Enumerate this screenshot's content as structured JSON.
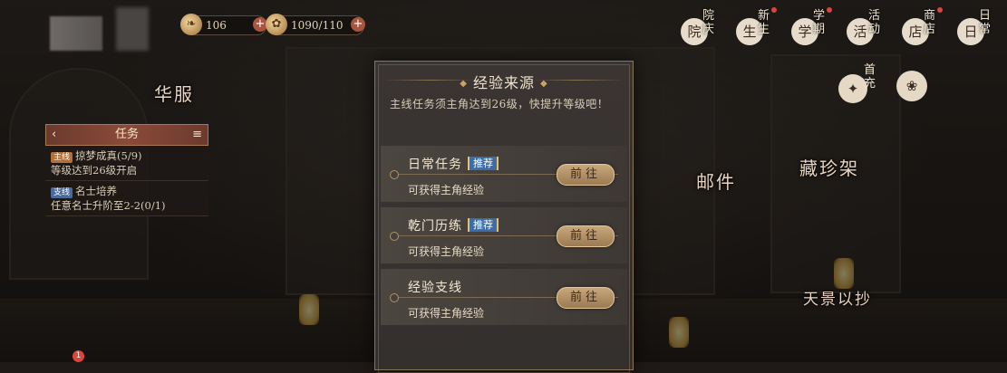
{
  "resources": {
    "stamina": "106",
    "energy": "1090/110"
  },
  "topnav": [
    {
      "label": "院庆",
      "icon": "courtyard-icon",
      "glyph": "院",
      "dot": false
    },
    {
      "label": "新生",
      "icon": "newborn-icon",
      "glyph": "生",
      "dot": true
    },
    {
      "label": "学期",
      "icon": "semester-icon",
      "glyph": "学",
      "dot": true
    },
    {
      "label": "活动",
      "icon": "activity-icon",
      "glyph": "活",
      "dot": false
    },
    {
      "label": "商店",
      "icon": "shop-icon",
      "glyph": "店",
      "dot": true
    },
    {
      "label": "日常",
      "icon": "daily-icon",
      "glyph": "日",
      "dot": false
    }
  ],
  "side": {
    "first_charge": "首充"
  },
  "scene_labels": {
    "costume": "华服",
    "mail": "邮件",
    "treasure_rack": "藏珍架",
    "tianjing": "天景以抄"
  },
  "task_panel": {
    "title": "任务",
    "items": [
      {
        "tag": "主线",
        "text": "掠梦成真(5/9)",
        "sub": "等级达到26级开启"
      },
      {
        "tag": "支线",
        "text": "名士培养",
        "sub": "任意名士升阶至2-2(0/1)"
      }
    ]
  },
  "dialog": {
    "title": "经验来源",
    "subtitle": "主线任务须主角达到26级，快提升等级吧！",
    "sources": [
      {
        "name": "日常任务",
        "recommended": "推荐",
        "desc": "可获得主角经验",
        "button": "前往"
      },
      {
        "name": "乾门历练",
        "recommended": "推荐",
        "desc": "可获得主角经验",
        "button": "前往"
      },
      {
        "name": "经验支线",
        "recommended": "",
        "desc": "可获得主角经验",
        "button": "前往"
      }
    ]
  },
  "notification_count": "1",
  "colors": {
    "accent_gold": "#c9a77c",
    "recommend_blue": "#3b6ea8",
    "alert_red": "#d8453a"
  }
}
